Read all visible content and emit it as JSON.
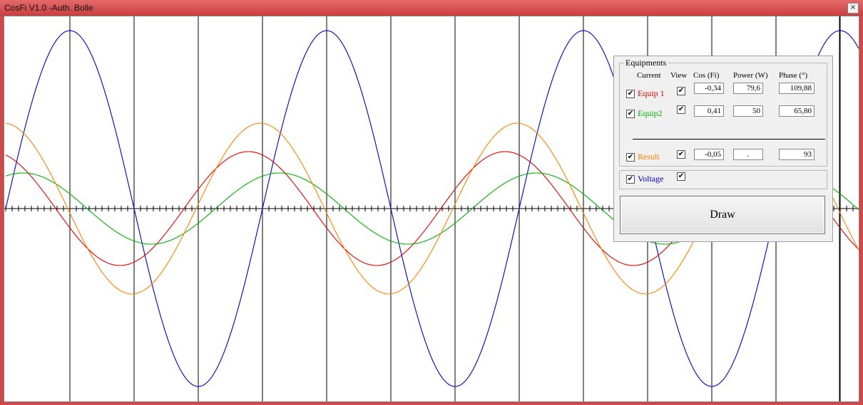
{
  "window": {
    "title": "CosFi V1.0 -Auth. Bolle",
    "close_symbol": "×"
  },
  "panel": {
    "group_title": "Equipments",
    "headers": {
      "current": "Current",
      "view": "View",
      "cos": "Cos (Fi)",
      "power": "Power (W)",
      "phase": "Phase (°)"
    },
    "rows": [
      {
        "label": "Equip 1",
        "color": "#e00000",
        "cos": "-0,34",
        "power": "79,6",
        "phase": "109,88"
      },
      {
        "label": "Equip2",
        "color": "#00b000",
        "cos": "0,41",
        "power": "50",
        "phase": "65,80"
      }
    ],
    "result": {
      "label": "Result",
      "color": "#ff8000",
      "cos": "-0,05",
      "power": ".",
      "phase": "93"
    },
    "voltage": {
      "label": "Voltage",
      "color": "#0000c0"
    },
    "check_symbol": "✔",
    "draw_button": "Draw"
  },
  "chart_data": {
    "type": "line",
    "series": [
      {
        "color": "#0000c0",
        "amplitude": 1.0,
        "phase_deg": 0
      },
      {
        "color": "#e00000",
        "amplitude": 0.32,
        "phase_deg": 109.88
      },
      {
        "color": "#00b000",
        "amplitude": 0.2,
        "phase_deg": 65.8
      },
      {
        "color": "#ff8000",
        "amplitude": 0.48,
        "phase_deg": 93
      }
    ],
    "grid": true
  }
}
